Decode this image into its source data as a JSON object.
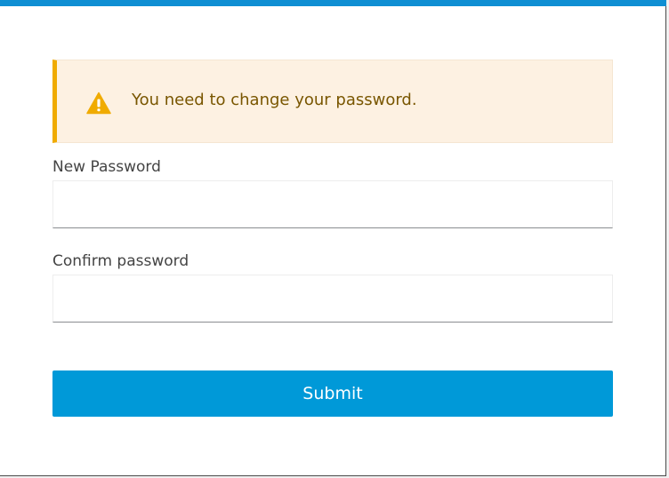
{
  "alert": {
    "icon": "warning-triangle-icon",
    "message": "You need to change your password.",
    "accent_color": "#f0ab00",
    "background_color": "#fdf1e2"
  },
  "form": {
    "new_password_label": "New Password",
    "new_password_value": "",
    "confirm_password_label": "Confirm password",
    "confirm_password_value": "",
    "submit_label": "Submit"
  },
  "colors": {
    "top_bar": "#0f8fd3",
    "button": "#0099d8"
  }
}
